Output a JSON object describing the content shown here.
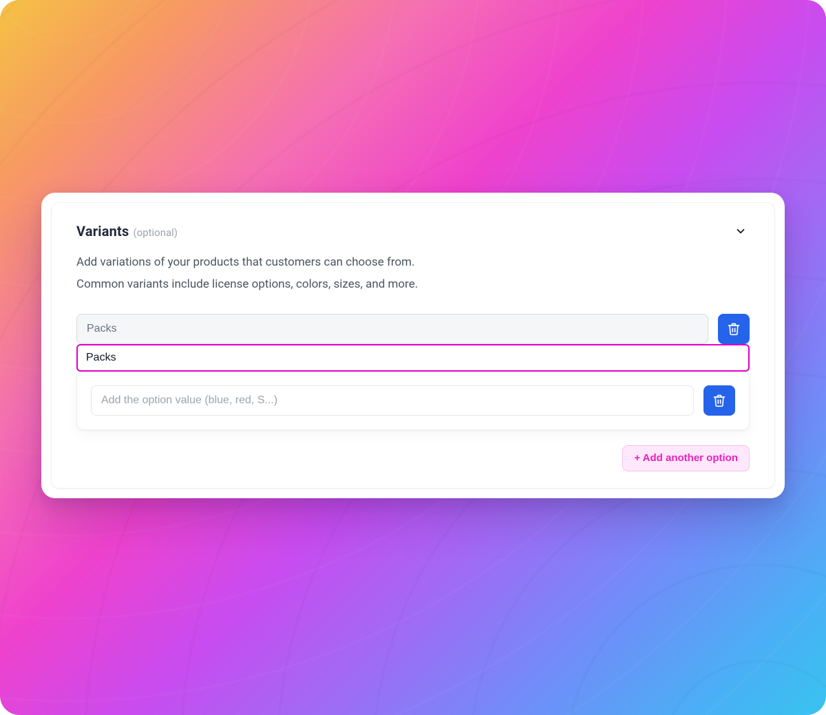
{
  "variants_section": {
    "title": "Variants",
    "optional_label": "(optional)",
    "description_line1": "Add variations of your products that customers can choose from.",
    "description_line2": "Common variants include license options, colors, sizes, and more.",
    "option_name_display": "Packs",
    "option_name_active_value": "Packs",
    "option_value_placeholder": "Add the option value (blue, red, S...)",
    "add_option_label": "+ Add another option"
  },
  "colors": {
    "accent_pink": "#ea1fbf",
    "accent_blue": "#2563eb",
    "focus_magenta": "#e100c6"
  }
}
